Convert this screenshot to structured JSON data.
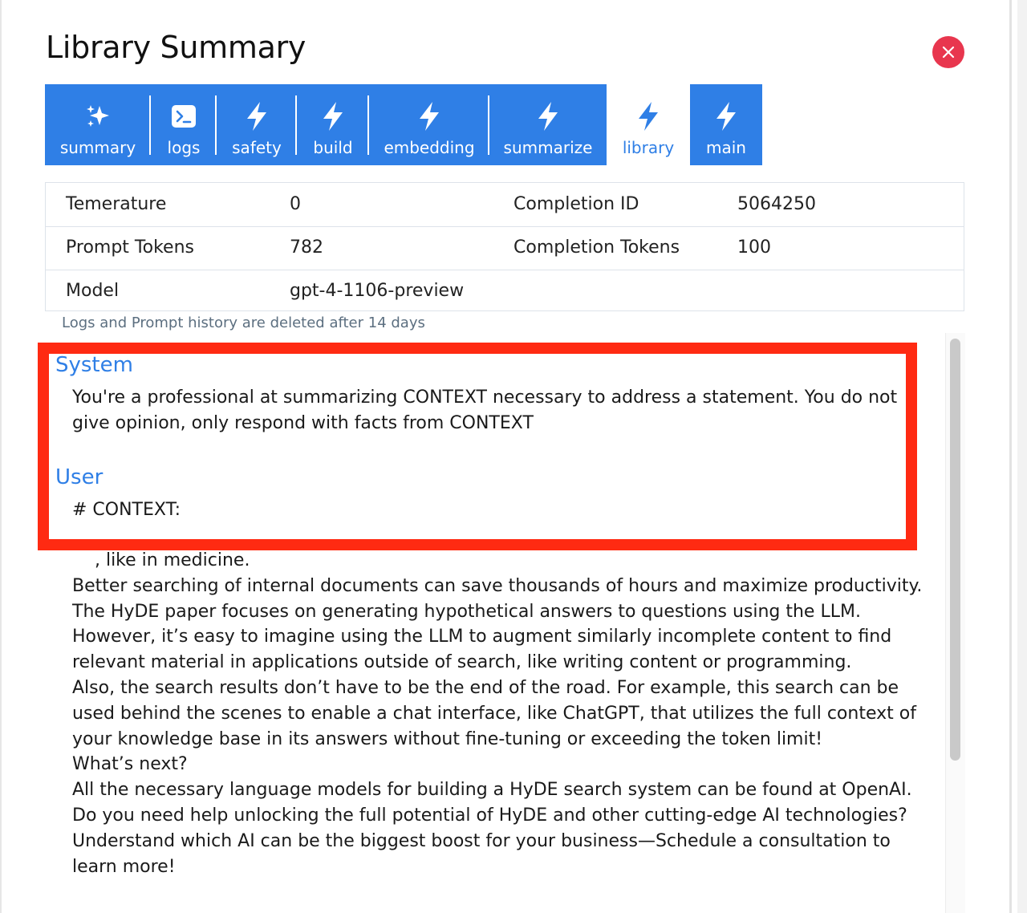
{
  "modal": {
    "title": "Library Summary"
  },
  "tabs": [
    {
      "label": "summary",
      "icon": "sparkles-icon",
      "active": false
    },
    {
      "label": "logs",
      "icon": "terminal-icon",
      "active": false
    },
    {
      "label": "safety",
      "icon": "bolt-icon",
      "active": false
    },
    {
      "label": "build",
      "icon": "bolt-icon",
      "active": false
    },
    {
      "label": "embedding",
      "icon": "bolt-icon",
      "active": false
    },
    {
      "label": "summarize",
      "icon": "bolt-icon",
      "active": false
    },
    {
      "label": "library",
      "icon": "bolt-icon",
      "active": true
    },
    {
      "label": "main",
      "icon": "bolt-icon",
      "active": false
    }
  ],
  "details": {
    "temperature_label": "Temerature",
    "temperature_value": "0",
    "completion_id_label": "Completion ID",
    "completion_id_value": "5064250",
    "prompt_tokens_label": "Prompt Tokens",
    "prompt_tokens_value": "782",
    "completion_tokens_label": "Completion Tokens",
    "completion_tokens_value": "100",
    "model_label": "Model",
    "model_value": "gpt-4-1106-preview"
  },
  "retention_note": "Logs and Prompt history are deleted after 14 days",
  "messages": {
    "system_role": "System",
    "system_lines": [
      "You're a professional at summarizing CONTEXT necessary to address a statement. You do not",
      "give opinion, only respond with facts from CONTEXT"
    ],
    "user_role": "User",
    "user_first_line": "# CONTEXT:",
    "user_body_lines": [
      "    , like in medicine.",
      "Better searching of internal documents can save thousands of hours and maximize productivity.",
      "The HyDE paper focuses on generating hypothetical answers to questions using the LLM.",
      "However, it’s easy to imagine using the LLM to augment similarly incomplete content to find",
      "relevant material in applications outside of search, like writing content or programming.",
      "Also, the search results don’t have to be the end of the road. For example, this search can be",
      "used behind the scenes to enable a chat interface, like ChatGPT, that utilizes the full context of",
      "your knowledge base in its answers without fine-tuning or exceeding the token limit!",
      "What’s next?",
      "All the necessary language models for building a HyDE search system can be found at OpenAI.",
      "Do you need help unlocking the full potential of HyDE and other cutting-edge AI technologies?",
      "Understand which AI can be the biggest boost for your business—Schedule a consultation to",
      "learn more!"
    ]
  },
  "colors": {
    "tab_blue": "#2f7fe6",
    "close_red": "#e8364e",
    "highlight_red": "#ff2a12",
    "role_blue": "#2f7fe6"
  }
}
